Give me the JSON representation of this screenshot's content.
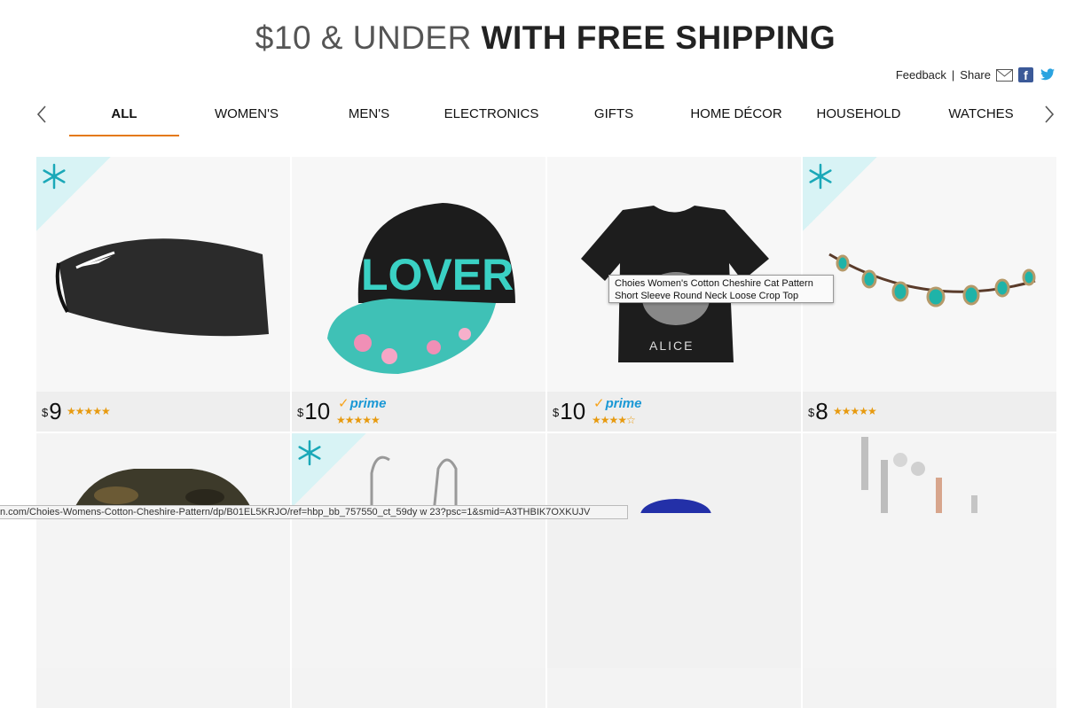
{
  "headline": {
    "prefix": "$10 & UNDER ",
    "bold": "WITH FREE SHIPPING"
  },
  "social": {
    "feedback": "Feedback",
    "sep": "|",
    "share": "Share"
  },
  "tabs": [
    "ALL",
    "WOMEN'S",
    "MEN'S",
    "ELECTRONICS",
    "GIFTS",
    "HOME DÉCOR",
    "HOUSEHOLD",
    "WATCHES"
  ],
  "active_tab": "ALL",
  "products": [
    {
      "price_symbol": "$",
      "price": "9",
      "prime": "",
      "rating": 4.5,
      "has_badge": true,
      "image": "black-headband"
    },
    {
      "price_symbol": "$",
      "price": "10",
      "prime": "prime",
      "rating": 4.5,
      "has_badge": false,
      "image": "lover-snapback-cap"
    },
    {
      "price_symbol": "$",
      "price": "10",
      "prime": "prime",
      "rating": 4,
      "has_badge": false,
      "image": "alice-crop-top"
    },
    {
      "price_symbol": "$",
      "price": "8",
      "prime": "",
      "rating": 4.5,
      "has_badge": true,
      "image": "beaded-headband"
    }
  ],
  "row2": [
    {
      "image": "camo-shirt",
      "has_badge": false
    },
    {
      "image": "metal-hooks",
      "has_badge": true
    },
    {
      "image": "blue-item",
      "has_badge": false
    },
    {
      "image": "bar-earrings",
      "has_badge": false
    }
  ],
  "tooltip": {
    "line1": "Choies Women's Cotton Cheshire Cat Pattern",
    "line2": "Short Sleeve Round Neck Loose Crop Top"
  },
  "status_url": "n.com/Choies-Womens-Cotton-Cheshire-Pattern/dp/B01EL5KRJO/ref=hbp_bb_757550_ct_59dy w 23?psc=1&smid=A3THBIK7OXKUJV",
  "colors": {
    "accent": "#e47911",
    "prime_blue": "#1a98d5",
    "star": "#e79a0f",
    "badge_bg": "#d8f3f5",
    "snowflake": "#1aa8b8"
  }
}
